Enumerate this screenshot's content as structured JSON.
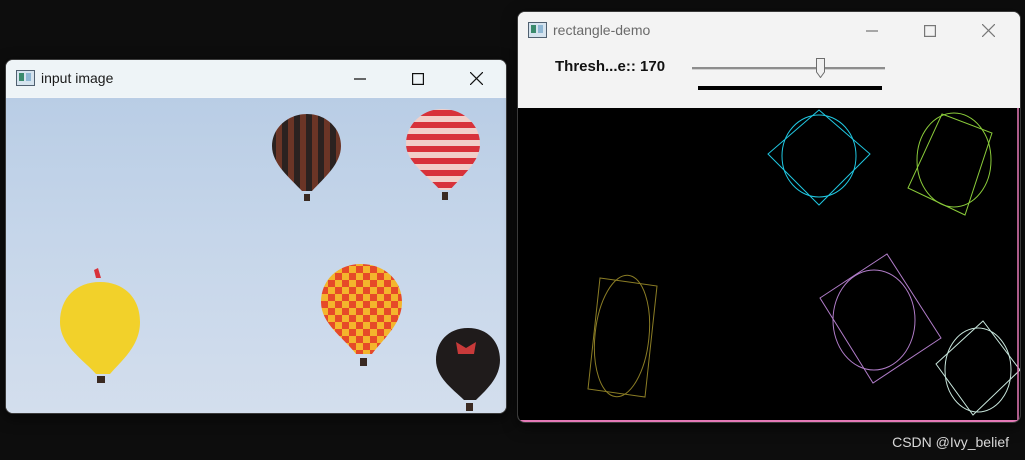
{
  "windows": {
    "input": {
      "title": "input image",
      "icon": "app-icon",
      "controls": [
        "minimize-icon",
        "maximize-icon",
        "close-icon"
      ]
    },
    "demo": {
      "title": "rectangle-demo",
      "icon": "app-icon",
      "controls": [
        "minimize-icon",
        "maximize-icon",
        "close-icon"
      ],
      "trackbar": {
        "label": "Thresh...e:: 170",
        "value": 170,
        "max": 255
      }
    }
  },
  "balloons": [
    {
      "name": "balloon-dark-stripes",
      "colors": [
        "#2b2220",
        "#7a3a2a"
      ]
    },
    {
      "name": "balloon-red-white",
      "colors": [
        "#d8323a",
        "#f4d6d0"
      ]
    },
    {
      "name": "balloon-yellow",
      "colors": [
        "#f2d12a",
        "#d9a81a"
      ]
    },
    {
      "name": "balloon-checker",
      "colors": [
        "#e64a28",
        "#f4b52c"
      ]
    },
    {
      "name": "balloon-black-red",
      "colors": [
        "#1f1b1b",
        "#c83a3a"
      ]
    }
  ],
  "contour_colors": {
    "cyan": "#20c6e0",
    "green": "#8acb3a",
    "olive": "#8b7d25",
    "purple": "#b07cc8",
    "white": "#c8e6dc"
  },
  "watermark": "CSDN @Ivy_belief"
}
